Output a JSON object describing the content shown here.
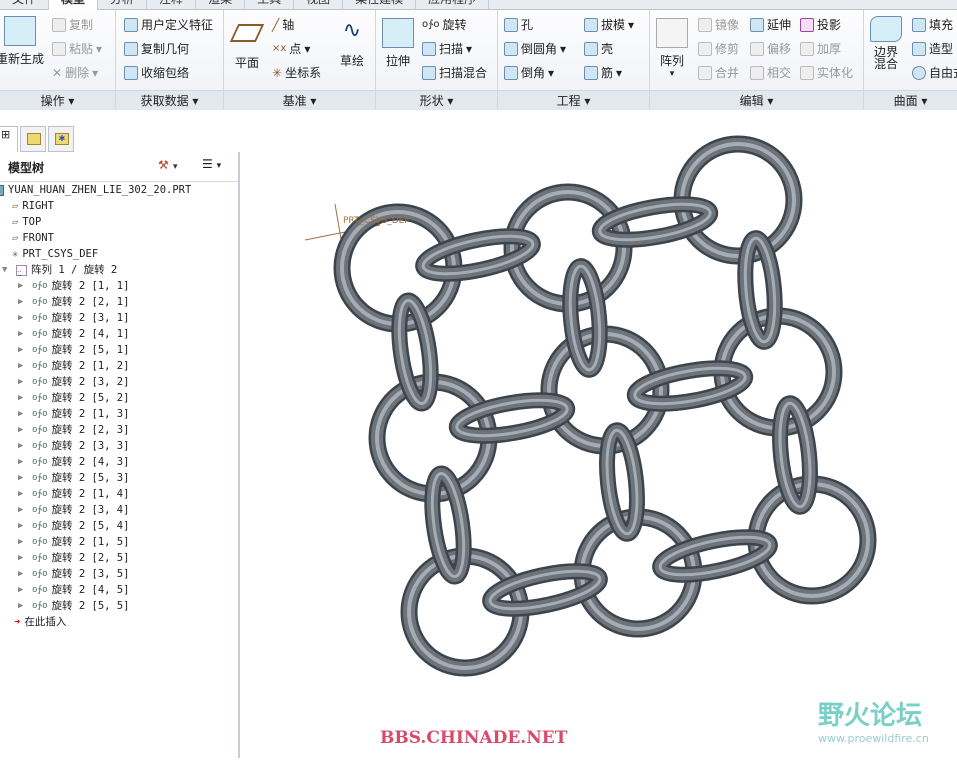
{
  "tabs": [
    "文件",
    "模型",
    "分析",
    "注释",
    "渲染",
    "工具",
    "视图",
    "柔性建模",
    "应用程序"
  ],
  "active_tab": "模型",
  "ribbon": {
    "operations": {
      "label": "操作",
      "regenerate": "重新生成",
      "copy": "复制",
      "paste": "粘贴",
      "delete": "删除"
    },
    "get_data": {
      "label": "获取数据",
      "udf": "用户定义特征",
      "copy_geom": "复制几何",
      "shrinkwrap": "收缩包络"
    },
    "datum": {
      "label": "基准",
      "plane": "平面",
      "axis": "轴",
      "point": "点",
      "csys": "坐标系",
      "sketch": "草绘"
    },
    "shapes": {
      "label": "形状",
      "extrude": "拉伸",
      "revolve": "旋转",
      "sweep": "扫描",
      "swept_blend": "扫描混合"
    },
    "engineering": {
      "label": "工程",
      "hole": "孔",
      "round": "倒圆角",
      "chamfer": "倒角",
      "draft": "拔模",
      "shell": "壳",
      "rib": "筋"
    },
    "editing": {
      "label": "编辑",
      "pattern": "阵列",
      "mirror": "镜像",
      "trim": "修剪",
      "merge": "合并",
      "extend": "延伸",
      "offset": "偏移",
      "intersect": "相交",
      "project": "投影",
      "thicken": "加厚",
      "solidify": "实体化"
    },
    "surfaces": {
      "label": "曲面",
      "boundary_blend": "边界混合",
      "fill": "填充",
      "style": "造型",
      "freestyle": "自由式"
    }
  },
  "model_tree": {
    "title": "模型树",
    "root": "YUAN_HUAN_ZHEN_LIE_302_20.PRT",
    "datums": [
      "RIGHT",
      "TOP",
      "FRONT",
      "PRT_CSYS_DEF"
    ],
    "pattern": "阵列 1 / 旋转 2",
    "members": [
      "旋转 2 [1, 1]",
      "旋转 2 [2, 1]",
      "旋转 2 [3, 1]",
      "旋转 2 [4, 1]",
      "旋转 2 [5, 1]",
      "旋转 2 [1, 2]",
      "旋转 2 [3, 2]",
      "旋转 2 [5, 2]",
      "旋转 2 [1, 3]",
      "旋转 2 [2, 3]",
      "旋转 2 [3, 3]",
      "旋转 2 [4, 3]",
      "旋转 2 [5, 3]",
      "旋转 2 [1, 4]",
      "旋转 2 [3, 4]",
      "旋转 2 [5, 4]",
      "旋转 2 [1, 5]",
      "旋转 2 [2, 5]",
      "旋转 2 [3, 5]",
      "旋转 2 [4, 5]",
      "旋转 2 [5, 5]"
    ],
    "insert_here": "在此插入"
  },
  "viewport": {
    "csys_label": "PRT_CSYS_DEF"
  },
  "watermarks": {
    "bbs": "BBS.CHINADE.NET",
    "forum": "野火论坛",
    "url": "www.proewildfire.cn"
  }
}
